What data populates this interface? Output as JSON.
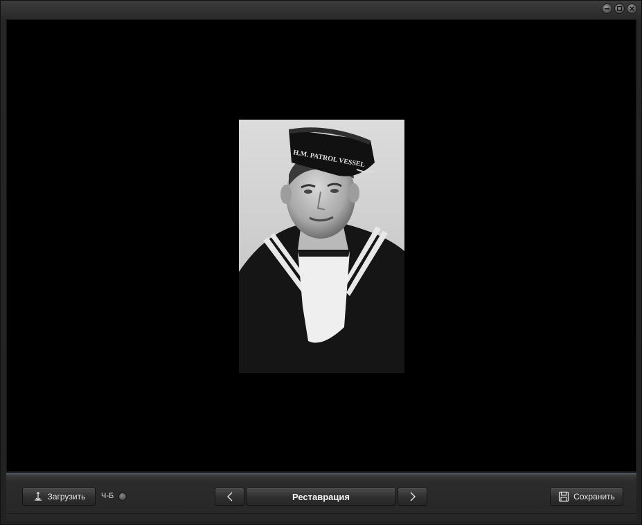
{
  "window": {
    "controls": [
      {
        "icon": "minimize-icon"
      },
      {
        "icon": "maximize-icon"
      },
      {
        "icon": "close-icon"
      }
    ]
  },
  "photo": {
    "description_visible_text": "H.M. PATROL VESSEL"
  },
  "toolbar": {
    "load_label": "Загрузить",
    "load_icon": "anchor-icon",
    "bw_label": "Ч-Б",
    "mode_label": "Реставрация",
    "prev_icon": "chevron-left-icon",
    "next_icon": "chevron-right-icon",
    "save_label": "Сохранить",
    "save_icon": "floppy-disk-icon"
  },
  "colors": {
    "viewport_bg": "#000000",
    "accent_line": "#4a5462",
    "button_text": "#e6e6e6"
  }
}
